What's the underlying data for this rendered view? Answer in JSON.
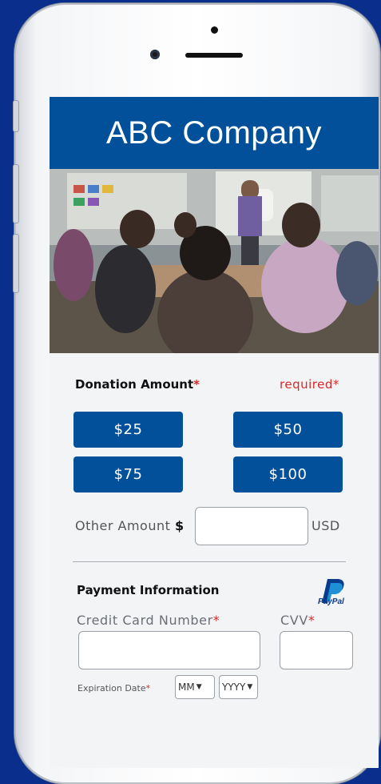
{
  "header": {
    "title": "ABC Company"
  },
  "photo": {
    "subject": "classroom with teacher and students"
  },
  "donation": {
    "label": "Donation Amount",
    "star": "*",
    "required_text": "required*",
    "amounts": [
      "$25",
      "$50",
      "$75",
      "$100"
    ],
    "other_label": "Other Amount",
    "other_currency_symbol": "$",
    "other_value": "",
    "currency": "USD"
  },
  "payment": {
    "title": "Payment Information",
    "paypal_text": "PayPal",
    "card_label": "Credit Card Number",
    "card_value": "",
    "cvv_label": "CVV",
    "cvv_value": "",
    "expiration_label": "Expiration Date",
    "month_selected": "MM",
    "year_selected": "YYYY"
  },
  "colors": {
    "brand_blue": "#03509a",
    "background_blue": "#0a2e8c",
    "required_red": "#d62828"
  }
}
